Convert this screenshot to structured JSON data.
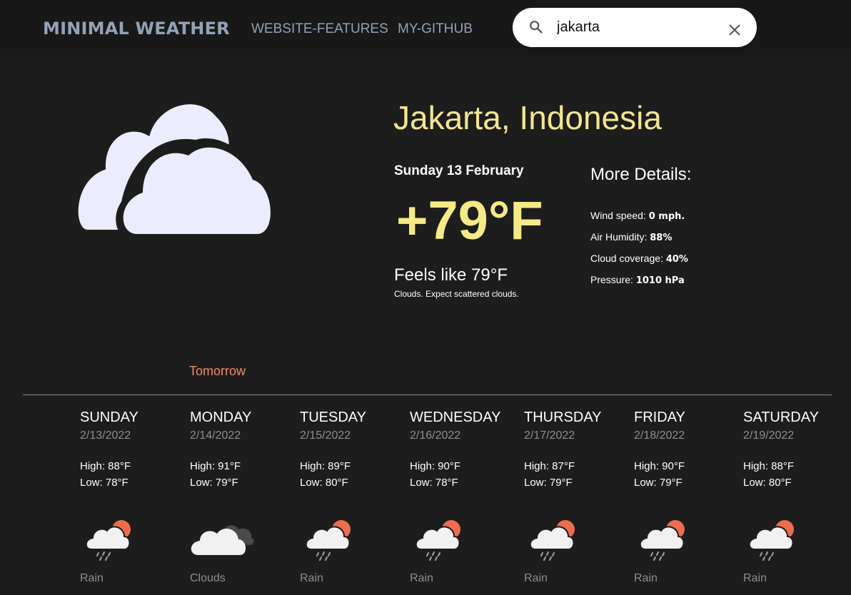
{
  "nav": {
    "brand": "MINIMAL WEATHER",
    "links": [
      "WEBSITE-FEATURES",
      "MY-GITHUB"
    ],
    "search_value": "jakarta"
  },
  "current": {
    "city": "Jakarta, Indonesia",
    "date": "Sunday 13 February",
    "temp": "+79°F",
    "feels_like": "Feels like 79°F",
    "description": "Clouds. Expect scattered clouds.",
    "icon": "clouds-icon"
  },
  "details": {
    "title": "More Details:",
    "items": [
      {
        "label": "Wind speed:",
        "value": "0 mph."
      },
      {
        "label": "Air Humidity:",
        "value": "88%"
      },
      {
        "label": "Cloud coverage:",
        "value": "40%"
      },
      {
        "label": "Pressure:",
        "value": "1010 hPa"
      }
    ]
  },
  "tomorrow_label": "Tomorrow",
  "forecast": [
    {
      "day": "SUNDAY",
      "date": "2/13/2022",
      "high": "High: 88°F",
      "low": "Low: 78°F",
      "condition": "Rain",
      "icon": "rain-sun-icon"
    },
    {
      "day": "MONDAY",
      "date": "2/14/2022",
      "high": "High: 91°F",
      "low": "Low: 79°F",
      "condition": "Clouds",
      "icon": "clouds-icon"
    },
    {
      "day": "TUESDAY",
      "date": "2/15/2022",
      "high": "High: 89°F",
      "low": "Low: 80°F",
      "condition": "Rain",
      "icon": "rain-sun-icon"
    },
    {
      "day": "WEDNESDAY",
      "date": "2/16/2022",
      "high": "High: 90°F",
      "low": "Low: 78°F",
      "condition": "Rain",
      "icon": "rain-sun-icon"
    },
    {
      "day": "THURSDAY",
      "date": "2/17/2022",
      "high": "High: 87°F",
      "low": "Low: 79°F",
      "condition": "Rain",
      "icon": "rain-sun-icon"
    },
    {
      "day": "FRIDAY",
      "date": "2/18/2022",
      "high": "High: 90°F",
      "low": "Low: 79°F",
      "condition": "Rain",
      "icon": "rain-sun-icon"
    },
    {
      "day": "SATURDAY",
      "date": "2/19/2022",
      "high": "High: 88°F",
      "low": "Low: 80°F",
      "condition": "Rain",
      "icon": "rain-sun-icon"
    }
  ],
  "colors": {
    "background": "#1d1d1d",
    "navbar": "#181818",
    "nav_text": "#93a2b5",
    "accent_yellow": "#f5ea85",
    "accent_orange": "#ee8a67"
  }
}
